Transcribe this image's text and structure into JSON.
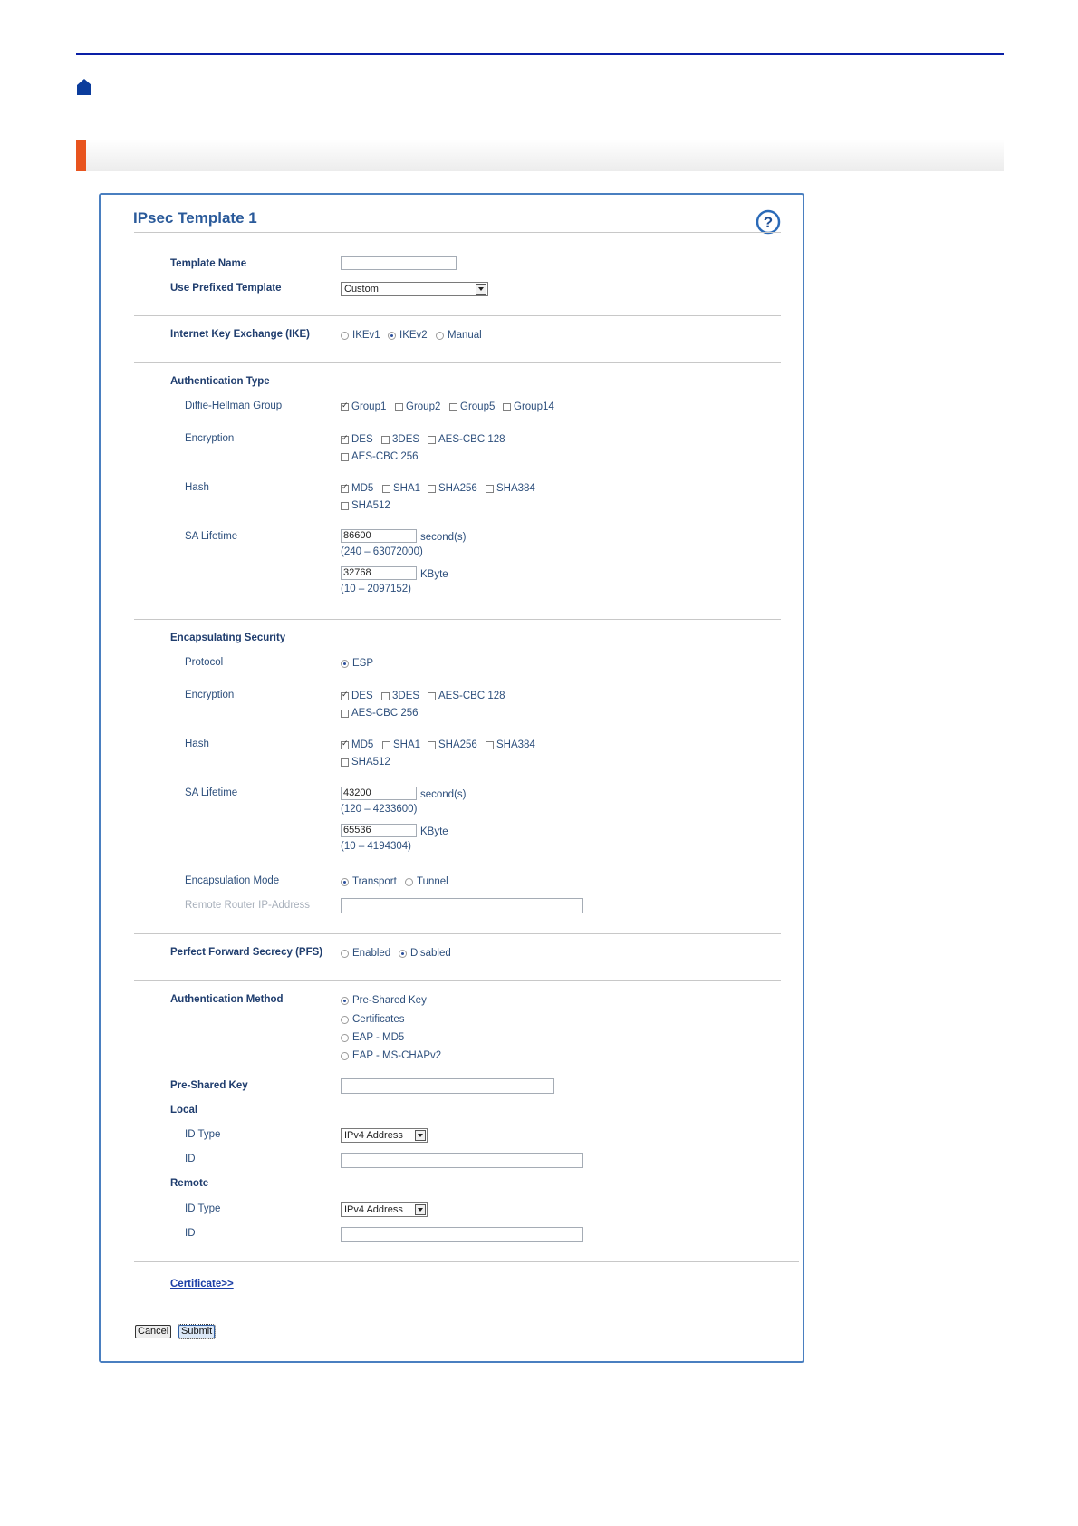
{
  "header": {
    "home_icon": "home-icon"
  },
  "colors": {
    "rule": "#0a1fa6",
    "accent": "#e8541e",
    "panel_border": "#4a7fc0"
  },
  "panel": {
    "title": "IPsec Template 1",
    "help_icon": "help-icon"
  },
  "template": {
    "name_label": "Template Name",
    "name_value": "",
    "prefixed_label": "Use Prefixed Template",
    "prefixed_value": "Custom"
  },
  "ike": {
    "label": "Internet Key Exchange (IKE)",
    "options": [
      "IKEv1",
      "IKEv2",
      "Manual"
    ],
    "selected": "IKEv2"
  },
  "auth_type": {
    "label": "Authentication Type",
    "dh_label": "Diffie-Hellman Group",
    "dh_options": [
      "Group1",
      "Group2",
      "Group5",
      "Group14"
    ],
    "enc_label": "Encryption",
    "enc_options": [
      "DES",
      "3DES",
      "AES-CBC 128",
      "AES-CBC 256"
    ],
    "hash_label": "Hash",
    "hash_options": [
      "MD5",
      "SHA1",
      "SHA256",
      "SHA384",
      "SHA512"
    ],
    "sa_label": "SA Lifetime",
    "sa_seconds": "86600",
    "sa_seconds_unit": "second(s)",
    "sa_seconds_range": "(240 – 63072000)",
    "sa_kbyte": "32768",
    "sa_kbyte_unit": "KByte",
    "sa_kbyte_range": "(10 – 2097152)"
  },
  "encap": {
    "label": "Encapsulating Security",
    "protocol_label": "Protocol",
    "protocol_value": "ESP",
    "enc_label": "Encryption",
    "enc_options": [
      "DES",
      "3DES",
      "AES-CBC 128",
      "AES-CBC 256"
    ],
    "hash_label": "Hash",
    "hash_options": [
      "MD5",
      "SHA1",
      "SHA256",
      "SHA384",
      "SHA512"
    ],
    "sa_label": "SA Lifetime",
    "sa_seconds": "43200",
    "sa_seconds_unit": "second(s)",
    "sa_seconds_range": "(120 – 4233600)",
    "sa_kbyte": "65536",
    "sa_kbyte_unit": "KByte",
    "sa_kbyte_range": "(10 – 4194304)",
    "mode_label": "Encapsulation Mode",
    "mode_options": [
      "Transport",
      "Tunnel"
    ],
    "remote_label": "Remote Router IP-Address",
    "remote_value": ""
  },
  "pfs": {
    "label": "Perfect Forward Secrecy (PFS)",
    "options": [
      "Enabled",
      "Disabled"
    ]
  },
  "auth_method": {
    "label": "Authentication Method",
    "options": [
      "Pre-Shared Key",
      "Certificates",
      "EAP - MD5",
      "EAP - MS-CHAPv2"
    ],
    "psk_label": "Pre-Shared Key",
    "psk_value": "",
    "local_label": "Local",
    "local_idtype_label": "ID Type",
    "local_idtype_value": "IPv4 Address",
    "local_id_label": "ID",
    "local_id_value": "",
    "remote_label": "Remote",
    "remote_idtype_label": "ID Type",
    "remote_idtype_value": "IPv4 Address",
    "remote_id_label": "ID",
    "remote_id_value": ""
  },
  "footer": {
    "cert_link": "Certificate>>",
    "cancel": "Cancel",
    "submit": "Submit"
  }
}
